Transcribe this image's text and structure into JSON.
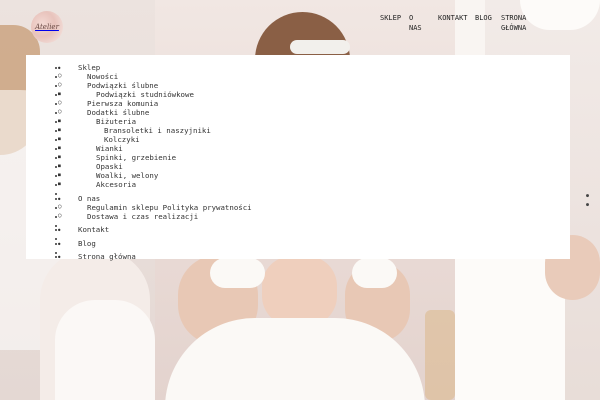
{
  "brand": {
    "logo_text": "Atelier"
  },
  "topnav": {
    "sklep": "SKLEP",
    "o_nas": "O NAS",
    "kontakt": "KONTAKT",
    "blog": "BLOG",
    "strona_glowna": "STRONA GŁÓWNA"
  },
  "menu": {
    "sklep": "Sklep",
    "nowosci": "Nowości",
    "podwiazki_slubne": "Podwiązki ślubne",
    "podwiazki_studniowkowe": "Podwiązki studniówkowe",
    "pierwsza_komunia": "Pierwsza komunia",
    "dodatki_slubne": "Dodatki ślubne",
    "bizuteria": "Biżuteria",
    "bransoletki": "Bransoletki i naszyjniki",
    "kolczyki": "Kolczyki",
    "wianki": "Wianki",
    "spinki": "Spinki, grzebienie",
    "opaski": "Opaski",
    "woalki": "Woalki, welony",
    "akcesoria": "Akcesoria",
    "o_nas": "O nas",
    "regulamin": "Regulamin sklepu Polityka prywatności",
    "dostawa": "Dostawa i czas realizacji",
    "kontakt": "Kontakt",
    "blog": "Blog",
    "strona_glowna": "Strona główna"
  },
  "colors": {
    "overlay_bg": "#ffffff",
    "text": "#333333"
  }
}
